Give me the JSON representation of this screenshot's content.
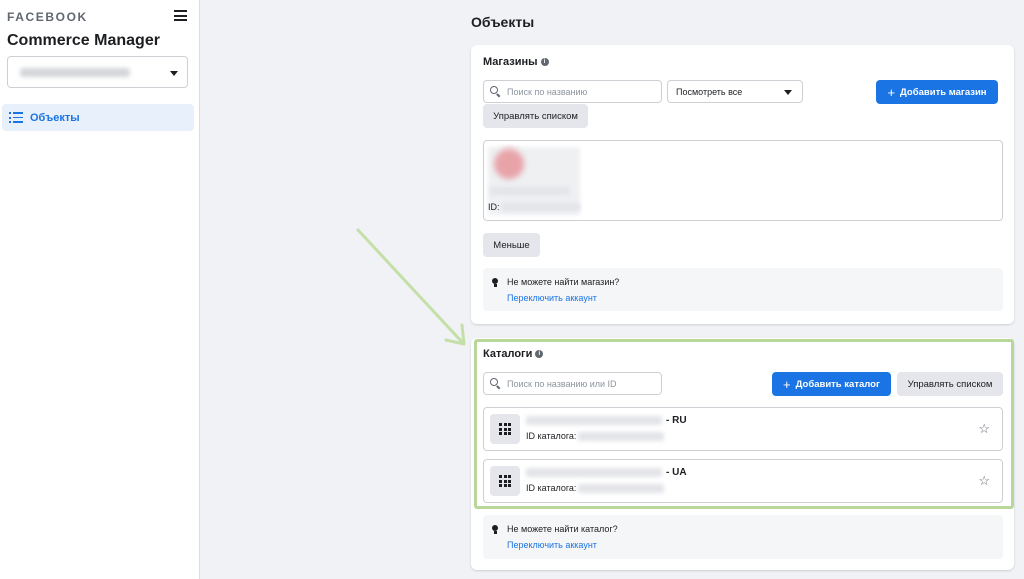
{
  "sidebar": {
    "brand": "FACEBOOK",
    "app_title": "Commerce Manager",
    "nav_items": [
      {
        "label": "Объекты",
        "icon": "list-icon"
      }
    ]
  },
  "main": {
    "page_title": "Объекты",
    "stores": {
      "title": "Магазины",
      "search_placeholder": "Поиск по названию",
      "filter_value": "Посмотреть все",
      "add_button": "Добавить магазин",
      "manage_button": "Управлять списком",
      "store_id_label": "ID:",
      "less_button": "Меньше",
      "notice_question": "Не можете найти магазин?",
      "notice_link": "Переключить аккаунт"
    },
    "catalogs": {
      "title": "Каталоги",
      "search_placeholder": "Поиск по названию или ID",
      "add_button": "Добавить каталог",
      "manage_button": "Управлять списком",
      "items": [
        {
          "suffix": "- RU",
          "id_label": "ID каталога:"
        },
        {
          "suffix": "- UA",
          "id_label": "ID каталога:"
        }
      ],
      "notice_question": "Не можете найти каталог?",
      "notice_link": "Переключить аккаунт"
    }
  },
  "colors": {
    "accent": "#1b74e4",
    "highlight_border": "#b9d79a",
    "arrow": "#c5dfa8"
  }
}
